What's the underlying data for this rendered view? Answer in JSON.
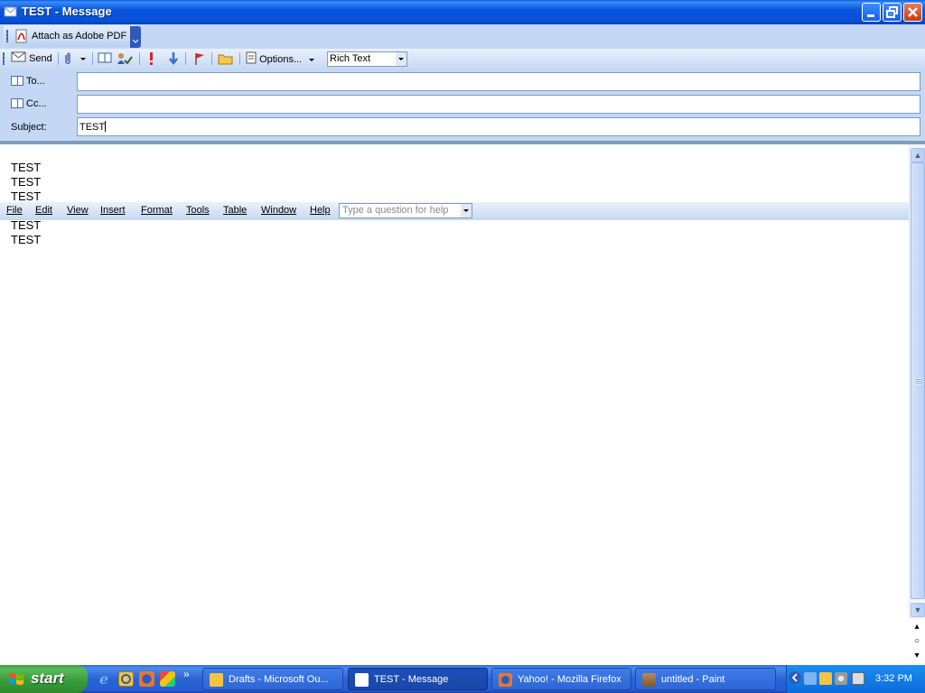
{
  "window": {
    "title": "TEST - Message"
  },
  "pdf_toolbar": {
    "attach_label": "Attach as Adobe PDF"
  },
  "toolbar": {
    "send_label": "Send",
    "options_label": "Options...",
    "format_value": "Rich Text"
  },
  "header": {
    "to_label": "To...",
    "cc_label": "Cc...",
    "subject_label": "Subject:",
    "to_value": "",
    "cc_value": "",
    "subject_value": "TEST"
  },
  "body": {
    "lines": [
      "TEST",
      "TEST",
      "TEST",
      "TEST",
      "TEST"
    ]
  },
  "menu": {
    "items": [
      "File",
      "Edit",
      "View",
      "Insert",
      "Format",
      "Tools",
      "Table",
      "Window",
      "Help"
    ],
    "help_placeholder": "Type a question for help"
  },
  "taskbar": {
    "start_label": "start",
    "tasks": [
      {
        "label": "Drafts - Microsoft Ou...",
        "active": false
      },
      {
        "label": "TEST - Message",
        "active": true
      },
      {
        "label": "Yahoo! - Mozilla Firefox",
        "active": false
      },
      {
        "label": "untitled - Paint",
        "active": false
      }
    ],
    "clock": "3:32 PM"
  },
  "colors": {
    "titlebar": "#0855dd",
    "toolbar_bg": "#c4d8f5",
    "taskbar": "#245edb",
    "start_green": "#379a37"
  }
}
